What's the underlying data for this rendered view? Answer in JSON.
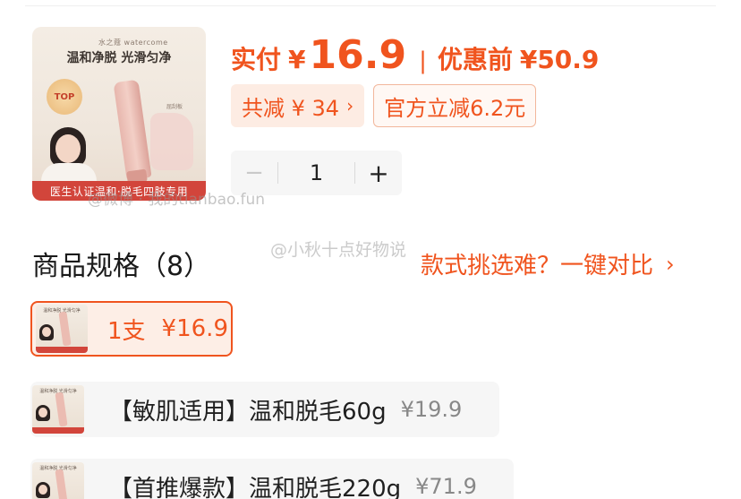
{
  "product": {
    "brand_text": "水之蔻 watercome",
    "headline": "温和净脱 光滑匀净",
    "badge": "TOP",
    "scraper_label": "屈刮板",
    "banner": "医生认证温和·脱毛四肢专用"
  },
  "price": {
    "actual_label": "实付",
    "currency": "¥",
    "actual_value": "16.9",
    "separator": "|",
    "original_label": "优惠前",
    "original_value": "¥50.9"
  },
  "discounts": {
    "total_label": "共减 ¥ 34",
    "total_chevron": "›",
    "coupon_label": "官方立减6.2元"
  },
  "quantity": {
    "minus": "−",
    "value": "1",
    "plus": "+"
  },
  "watermarks": {
    "mark1": "@微博 · 我的tianbao.fun",
    "mark2": "@小秋十点好物说"
  },
  "specs": {
    "title": "商品规格（8）",
    "compare_label": "款式挑选难？一键对比",
    "compare_chevron": "›",
    "options": [
      {
        "thumb_text": "温和净脱 光滑匀净",
        "name": "1支",
        "price": "¥16.9",
        "selected": true
      },
      {
        "thumb_text": "温和净脱 光滑匀净",
        "name": "【敏肌适用】温和脱毛60g",
        "price": "¥19.9",
        "selected": false
      },
      {
        "thumb_text": "温和净脱 光滑匀净",
        "name": "【首推爆款】温和脱毛220g",
        "price": "¥71.9",
        "selected": false
      }
    ]
  },
  "colors": {
    "accent": "#f0541e",
    "accent_bg": "#fdeee6",
    "option_bg": "#f6f6f6"
  }
}
